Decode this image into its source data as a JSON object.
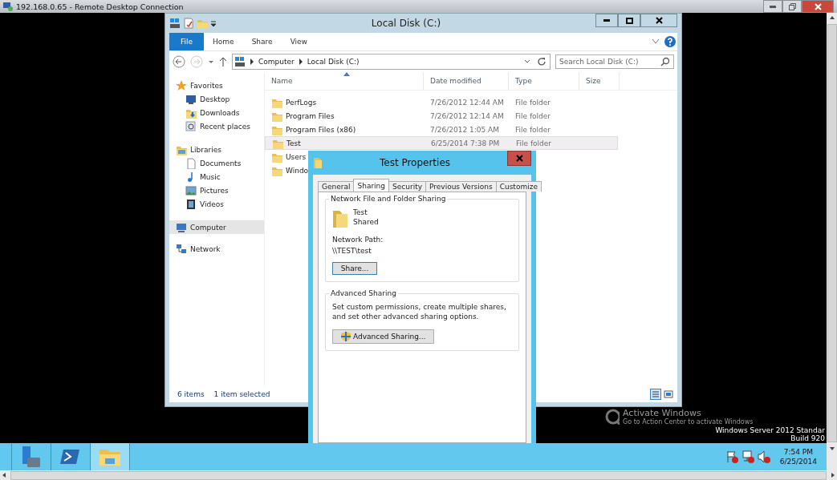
{
  "rdp_window": {
    "title": "192.168.0.65 - Remote Desktop Connection"
  },
  "explorer": {
    "title": "Local Disk (C:)",
    "ribbon_tabs": [
      {
        "label": "File",
        "kind": "file"
      },
      {
        "label": "Home",
        "kind": "tab"
      },
      {
        "label": "Share",
        "kind": "tab"
      },
      {
        "label": "View",
        "kind": "tab"
      }
    ],
    "breadcrumb": [
      "Computer",
      "Local Disk (C:)"
    ],
    "search": {
      "placeholder": "Search Local Disk (C:)"
    },
    "nav": [
      {
        "label": "Favorites",
        "kind": "favorites",
        "selected": false,
        "children": [
          {
            "label": "Desktop",
            "kind": "desktop",
            "selected": false
          },
          {
            "label": "Downloads",
            "kind": "downloads",
            "selected": false
          },
          {
            "label": "Recent places",
            "kind": "recent",
            "selected": false
          }
        ]
      },
      {
        "label": "Libraries",
        "kind": "libraries",
        "selected": false,
        "children": [
          {
            "label": "Documents",
            "kind": "documents",
            "selected": false
          },
          {
            "label": "Music",
            "kind": "music",
            "selected": false
          },
          {
            "label": "Pictures",
            "kind": "pictures",
            "selected": false
          },
          {
            "label": "Videos",
            "kind": "videos",
            "selected": false
          }
        ]
      },
      {
        "label": "Computer",
        "kind": "computer",
        "selected": true
      },
      {
        "label": "Network",
        "kind": "network",
        "selected": false
      }
    ],
    "columns": [
      "Name",
      "Date modified",
      "Type",
      "Size"
    ],
    "files": [
      {
        "name": "PerfLogs",
        "date": "7/26/2012 12:44 AM",
        "type": "File folder",
        "selected": false
      },
      {
        "name": "Program Files",
        "date": "7/26/2012 12:14 AM",
        "type": "File folder",
        "selected": false
      },
      {
        "name": "Program Files (x86)",
        "date": "7/26/2012 1:05 AM",
        "type": "File folder",
        "selected": false
      },
      {
        "name": "Test",
        "date": "6/25/2014 7:38 PM",
        "type": "File folder",
        "selected": true
      },
      {
        "name": "Users",
        "selected": false
      },
      {
        "name": "Windo",
        "selected": false
      }
    ],
    "status": [
      "6 items",
      "1 item selected"
    ]
  },
  "dialog": {
    "title": "Test Properties",
    "tabs": [
      {
        "label": "General",
        "selected": false
      },
      {
        "label": "Sharing",
        "selected": true
      },
      {
        "label": "Security",
        "selected": false
      },
      {
        "label": "Previous Versions",
        "selected": false
      },
      {
        "label": "Customize",
        "selected": false
      }
    ],
    "network_sharing": {
      "heading": "Network File and Folder Sharing",
      "name": "Test",
      "state": "Shared",
      "path_label": "Network Path:",
      "path": "\\\\TEST\\test",
      "button": "Share..."
    },
    "advanced_sharing": {
      "heading": "Advanced Sharing",
      "description": "Set custom permissions, create multiple shares, and set other advanced sharing options.",
      "button": "Advanced Sharing..."
    }
  },
  "desktop": {
    "activation_title": "Activate Windows",
    "activation_hint": "Go to Action Center to activate Windows",
    "edition": "Windows Server 2012 Standar",
    "build": "Build 920"
  },
  "taskbar": {
    "apps": [
      {
        "kind": "server-manager",
        "selected": false
      },
      {
        "kind": "powershell",
        "selected": false
      },
      {
        "kind": "explorer",
        "selected": true
      }
    ],
    "time": "7:54 PM",
    "date": "6/25/2014"
  }
}
